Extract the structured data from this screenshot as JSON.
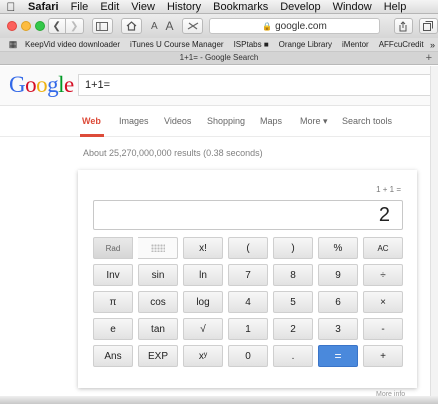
{
  "menubar": {
    "app": "Safari",
    "items": [
      "File",
      "Edit",
      "View",
      "History",
      "Bookmarks",
      "Develop",
      "Window",
      "Help"
    ]
  },
  "toolbar": {
    "url": "google.com",
    "text_size_small": "A",
    "text_size_large": "A"
  },
  "bookmarks": {
    "items": [
      "KeepVid video downloader",
      "iTunes U Course Manager",
      "ISPtabs ■",
      "Orange Library",
      "iMentor",
      "AFFcuCredit"
    ],
    "more": "»"
  },
  "tab": {
    "title": "1+1= - Google Search"
  },
  "google": {
    "logo_letters": [
      {
        "ch": "G",
        "color": "#3369e8"
      },
      {
        "ch": "o",
        "color": "#d50f25"
      },
      {
        "ch": "o",
        "color": "#eeb211"
      },
      {
        "ch": "g",
        "color": "#3369e8"
      },
      {
        "ch": "l",
        "color": "#009925"
      },
      {
        "ch": "e",
        "color": "#d50f25"
      }
    ],
    "query": "1+1="
  },
  "nav": {
    "tabs": [
      "Web",
      "Images",
      "Videos",
      "Shopping",
      "Maps",
      "More ▾",
      "Search tools"
    ],
    "active": "Web",
    "accent": "#dd4b39"
  },
  "results_stats": "About 25,270,000,000 results (0.38 seconds)",
  "calculator": {
    "expression": "1 + 1 =",
    "result": "2",
    "rows": [
      [
        "Rad",
        "",
        "x!",
        "(",
        ")",
        "%",
        "AC"
      ],
      [
        "Inv",
        "sin",
        "ln",
        "7",
        "8",
        "9",
        "÷"
      ],
      [
        "π",
        "cos",
        "log",
        "4",
        "5",
        "6",
        "×"
      ],
      [
        "e",
        "tan",
        "√",
        "1",
        "2",
        "3",
        "-"
      ],
      [
        "Ans",
        "EXP",
        "xʸ",
        "0",
        ".",
        "=",
        "+"
      ]
    ],
    "equals_color": "#4a89dc"
  },
  "footer_peek": "More info"
}
